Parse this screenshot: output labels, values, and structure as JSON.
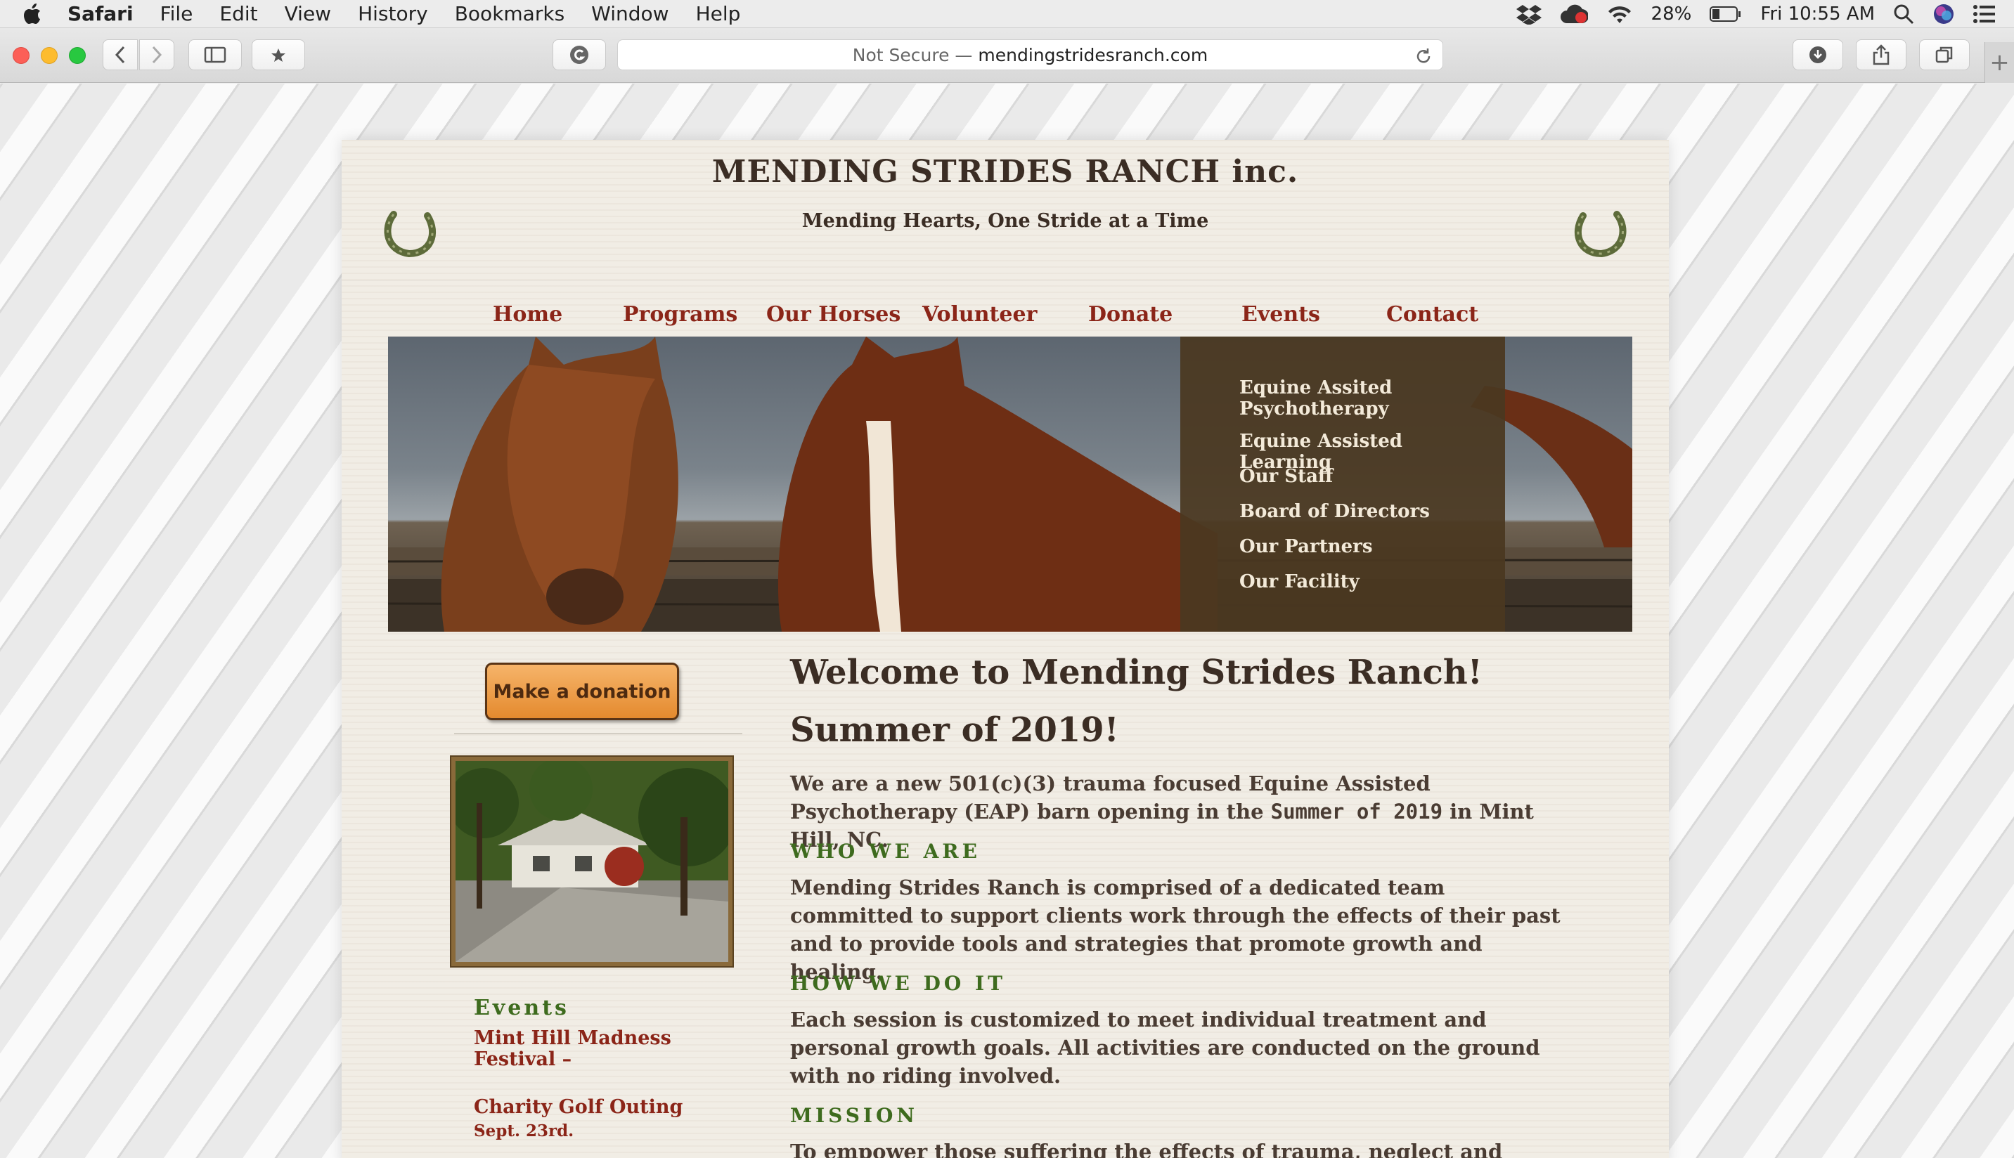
{
  "menubar": {
    "app": "Safari",
    "items": [
      "File",
      "Edit",
      "View",
      "History",
      "Bookmarks",
      "Window",
      "Help"
    ],
    "battery": "28%",
    "clock": "Fri 10:55 AM"
  },
  "browser": {
    "security": "Not Secure —",
    "domain": "mendingstridesranch.com"
  },
  "site": {
    "title": "MENDING STRIDES RANCH inc.",
    "tagline": "Mending Hearts, One Stride at a Time",
    "nav": [
      "Home",
      "Programs",
      "Our Horses",
      "Volunteer",
      "Donate",
      "Events",
      "Contact"
    ],
    "dropdown": [
      "Equine Assited Psychotherapy",
      "Equine Assisted Learning",
      "Our Staff",
      "Board of Directors",
      "Our Partners",
      "Our Facility"
    ],
    "donate_button": "Make a donation",
    "events": {
      "title": "Events",
      "items": [
        {
          "name": "Mint Hill Madness Festival –"
        },
        {
          "name": "Charity Golf Outing –",
          "date": "Sept. 23rd."
        }
      ]
    },
    "main": {
      "welcome": "Welcome to Mending Strides Ranch!",
      "summer": "Summer of 2019!",
      "intro_a": "We are a new 501(c)(3) trauma focused Equine Assisted Psychotherapy (EAP) barn opening in the ",
      "intro_b": "Summer of 2019",
      "intro_c": " in Mint Hill, NC.",
      "sections": [
        {
          "heading": "WHO WE ARE",
          "text": "Mending Strides Ranch is comprised of a dedicated team committed to support clients work through the effects of their past and to provide tools and strategies that promote growth and healing."
        },
        {
          "heading": "HOW WE DO IT",
          "text": "Each session is customized to meet individual treatment and personal growth goals. All activities are conducted on the ground with no riding involved."
        },
        {
          "heading": "MISSION",
          "text": "To empower those suffering the effects of trauma, neglect and hardships"
        }
      ]
    }
  },
  "colors": {
    "nav_text": "#8b2518",
    "heading_dark": "#3b2d24",
    "section_green": "#3e6b1e",
    "dropdown_bg": "#4a3820",
    "donate_orange": "#e48a2e"
  }
}
